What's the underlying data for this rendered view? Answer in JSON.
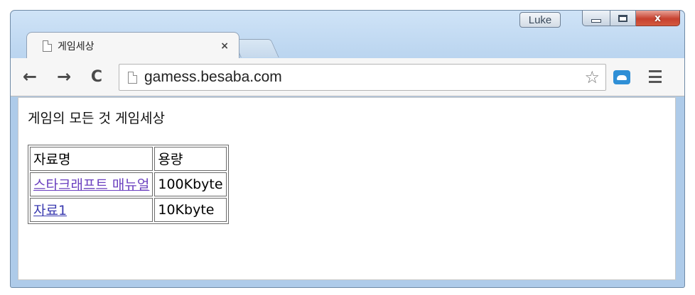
{
  "window": {
    "user_label": "Luke",
    "close_glyph": "x"
  },
  "tab": {
    "title": "게임세상",
    "close_glyph": "×"
  },
  "toolbar": {
    "back_glyph": "←",
    "forward_glyph": "→",
    "reload_glyph": "C",
    "url": "gamess.besaba.com",
    "star_glyph": "☆"
  },
  "page": {
    "heading": "게임의 모든 것 게임세상",
    "table": {
      "headers": [
        "자료명",
        "용량"
      ],
      "rows": [
        {
          "name": "스타크래프트 매뉴얼",
          "size": "100Kbyte"
        },
        {
          "name": "자료1",
          "size": "10Kbyte"
        }
      ]
    }
  },
  "colors": {
    "visited_link": "#6a3fbf",
    "link": "#3b3bb0",
    "close_button": "#c7412f"
  }
}
